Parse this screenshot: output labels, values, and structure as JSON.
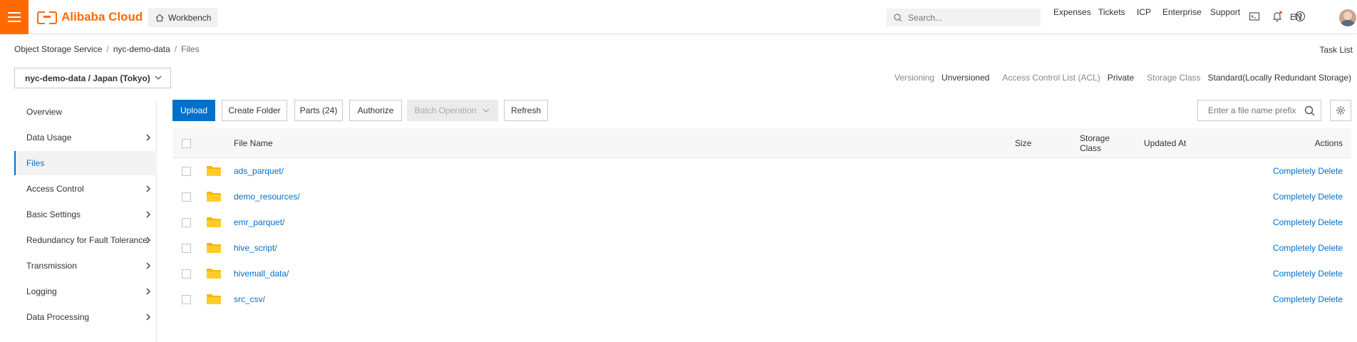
{
  "header": {
    "brand": "Alibaba Cloud",
    "workbench_label": "Workbench",
    "search_placeholder": "Search...",
    "links": {
      "expenses": "Expenses",
      "tickets": "Tickets",
      "icp": "ICP",
      "enterprise": "Enterprise",
      "support": "Support"
    },
    "language": "EN",
    "accent_color": "#ff6a00"
  },
  "breadcrumb": {
    "root": "Object Storage Service",
    "bucket": "nyc-demo-data",
    "current": "Files",
    "separator": "/"
  },
  "task_list": "Task List",
  "bucket_selector": {
    "value": "nyc-demo-data / Japan (Tokyo)"
  },
  "bucket_info": {
    "versioning_label": "Versioning",
    "versioning_value": "Unversioned",
    "acl_label": "Access Control List (ACL)",
    "acl_value": "Private",
    "storage_class_label": "Storage Class",
    "storage_class_value": "Standard(Locally Redundant Storage)"
  },
  "sidebar": {
    "items": [
      {
        "label": "Overview",
        "has_arrow": false
      },
      {
        "label": "Data Usage",
        "has_arrow": true
      },
      {
        "label": "Files",
        "has_arrow": false,
        "active": true
      },
      {
        "label": "Access Control",
        "has_arrow": true
      },
      {
        "label": "Basic Settings",
        "has_arrow": true
      },
      {
        "label": "Redundancy for Fault Tolerance",
        "has_arrow": true
      },
      {
        "label": "Transmission",
        "has_arrow": true
      },
      {
        "label": "Logging",
        "has_arrow": true
      },
      {
        "label": "Data Processing",
        "has_arrow": true
      }
    ]
  },
  "toolbar": {
    "upload": "Upload",
    "create_folder": "Create Folder",
    "parts": "Parts (24)",
    "authorize": "Authorize",
    "batch_operation": "Batch Operation",
    "refresh": "Refresh",
    "file_search_placeholder": "Enter a file name prefix"
  },
  "table": {
    "columns": {
      "file_name": "File Name",
      "size": "Size",
      "storage_class_line1": "Storage",
      "storage_class_line2": "Class",
      "updated_at": "Updated At",
      "actions": "Actions"
    },
    "rows": [
      {
        "name": "ads_parquet/",
        "action": "Completely Delete"
      },
      {
        "name": "demo_resources/",
        "action": "Completely Delete"
      },
      {
        "name": "emr_parquet/",
        "action": "Completely Delete"
      },
      {
        "name": "hive_script/",
        "action": "Completely Delete"
      },
      {
        "name": "hivemall_data/",
        "action": "Completely Delete"
      },
      {
        "name": "src_csv/",
        "action": "Completely Delete"
      }
    ]
  },
  "colors": {
    "link": "#0070cc",
    "primary_button": "#0070cc",
    "folder": "#ffc107"
  }
}
